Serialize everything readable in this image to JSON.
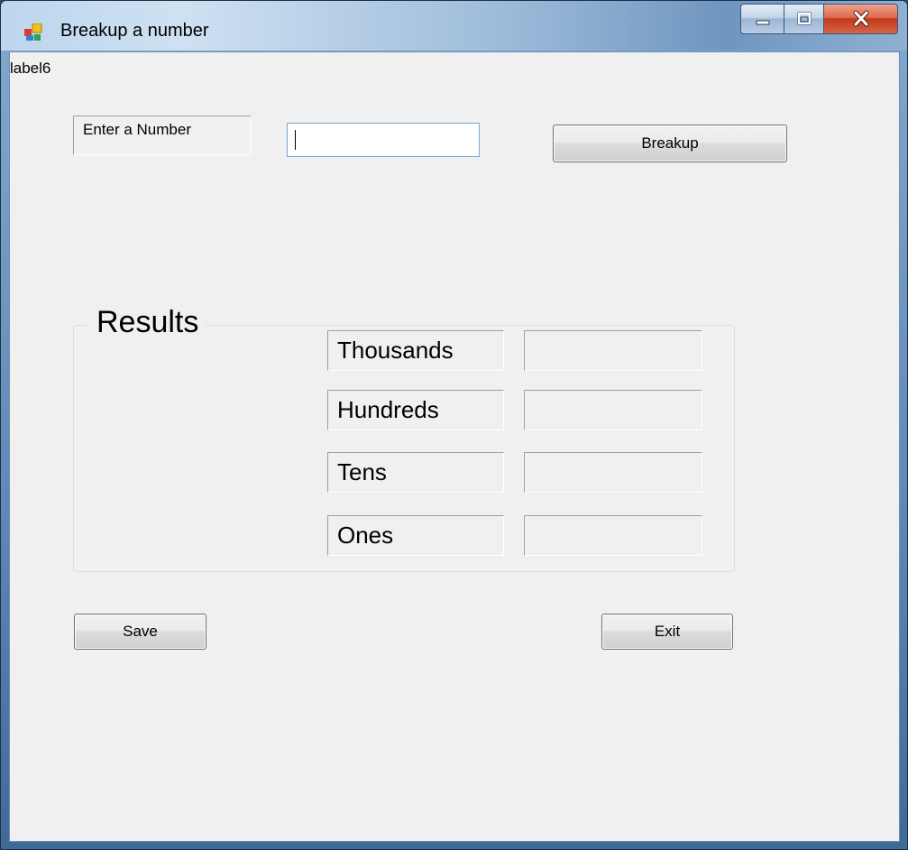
{
  "window": {
    "title": "Breakup a number",
    "icon": "winforms-app-icon",
    "caption_buttons": [
      "minimize-icon",
      "maximize-icon",
      "close-icon"
    ]
  },
  "form": {
    "label6": "label6",
    "enter_label": "Enter a Number",
    "number_input_value": "",
    "breakup_button": "Breakup"
  },
  "results": {
    "title": "Results",
    "rows": [
      {
        "label": "Thousands",
        "value": ""
      },
      {
        "label": "Hundreds",
        "value": ""
      },
      {
        "label": "Tens",
        "value": ""
      },
      {
        "label": "Ones",
        "value": ""
      }
    ]
  },
  "actions": {
    "save_button": "Save",
    "exit_button": "Exit"
  },
  "colors": {
    "client_bg": "#f0f0f0",
    "close_button": "#c2391a",
    "input_border": "#7ea6d0"
  }
}
